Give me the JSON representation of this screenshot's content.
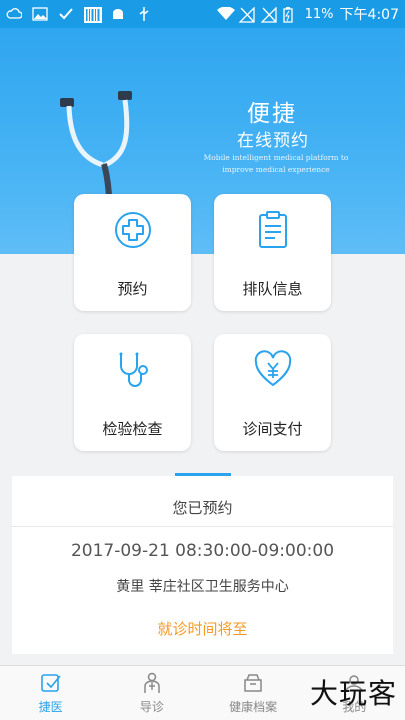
{
  "status_bar": {
    "battery": "11%",
    "time": "下午4:07"
  },
  "hero": {
    "title": "便捷",
    "subtitle": "在线预约",
    "english": "Mobile intelligent medical platform to improve medical experience"
  },
  "tiles": [
    {
      "label": "预约",
      "icon": "hospital-cross-icon"
    },
    {
      "label": "排队信息",
      "icon": "clipboard-icon"
    },
    {
      "label": "检验检查",
      "icon": "stethoscope-icon"
    },
    {
      "label": "诊间支付",
      "icon": "heart-yuan-icon"
    }
  ],
  "appointment": {
    "title": "您已预约",
    "time": "2017-09-21 08:30:00-09:00:00",
    "place": "黄里 莘庄社区卫生服务中心",
    "status": "就诊时间将至"
  },
  "bottom_nav": [
    {
      "label": "捷医",
      "icon": "jieyi-icon",
      "active": true
    },
    {
      "label": "导诊",
      "icon": "doctor-icon",
      "active": false
    },
    {
      "label": "健康档案",
      "icon": "archive-icon",
      "active": false
    },
    {
      "label": "我的",
      "icon": "profile-icon",
      "active": false
    }
  ],
  "watermark": "大玩客",
  "colors": {
    "primary": "#2aa3ee",
    "accent": "#f59a23"
  }
}
